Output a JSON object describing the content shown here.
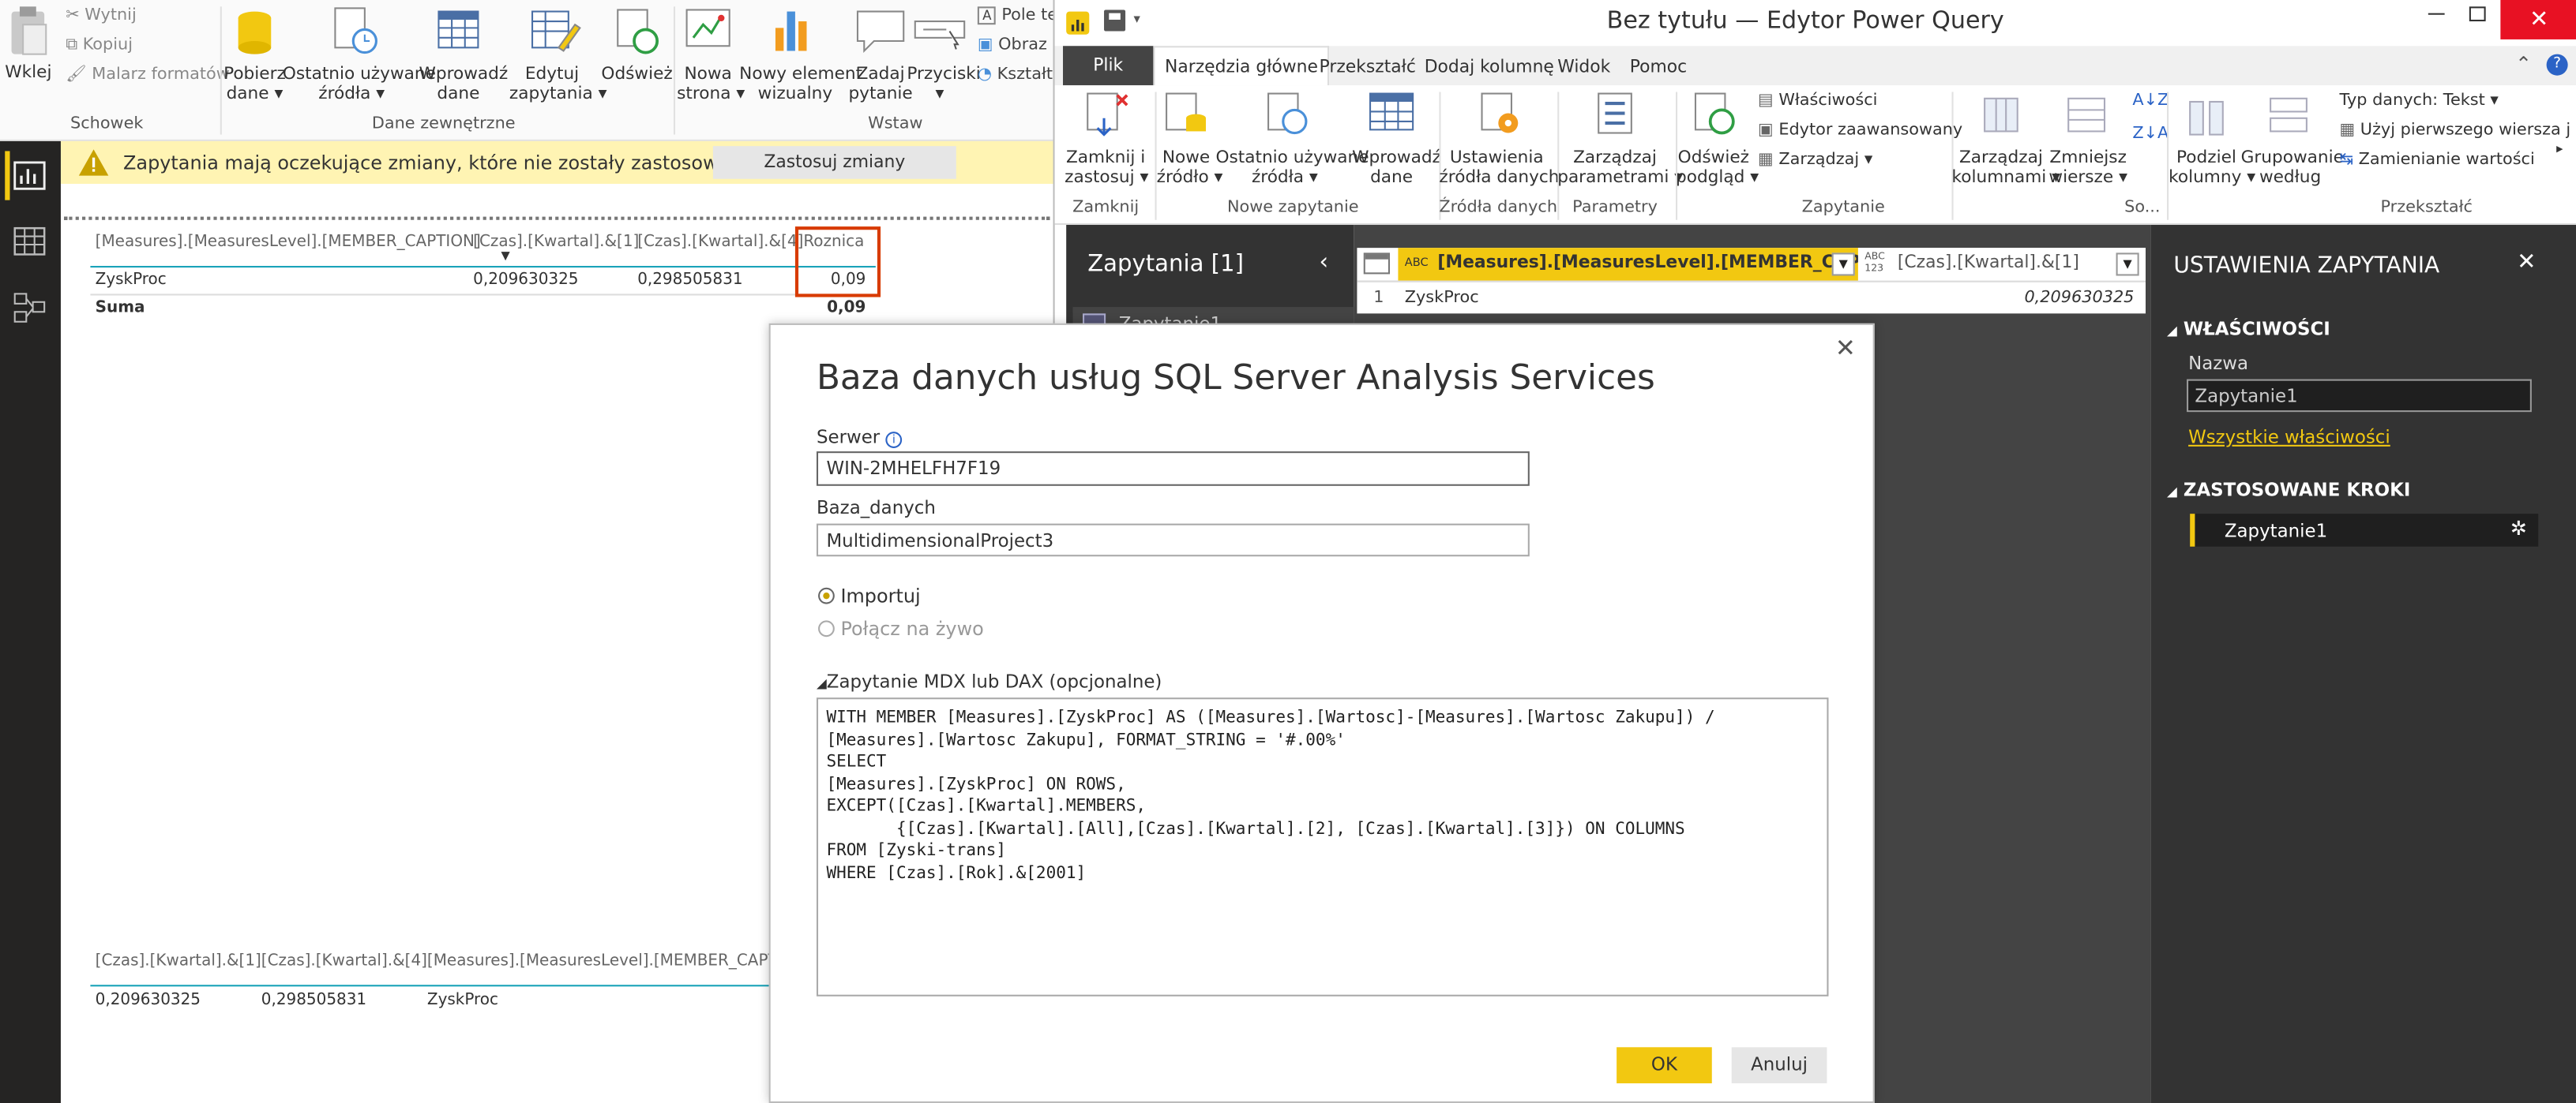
{
  "pbi": {
    "ribbon": {
      "clipboard": {
        "paste": "Wklej",
        "cut": "Wytnij",
        "copy": "Kopiuj",
        "format_painter": "Malarz formatów",
        "group": "Schowek"
      },
      "external": {
        "get_data_1": "Pobierz",
        "get_data_2": "dane",
        "recent_1": "Ostatnio używane",
        "recent_2": "źródła",
        "enter_1": "Wprowadź",
        "enter_2": "dane",
        "edit_1": "Edytuj",
        "edit_2": "zapytania",
        "refresh": "Odśwież",
        "group": "Dane zewnętrzne"
      },
      "insert": {
        "new_page_1": "Nowa",
        "new_page_2": "strona",
        "new_visual_1": "Nowy element",
        "new_visual_2": "wizualny",
        "ask_1": "Zadaj",
        "ask_2": "pytanie",
        "buttons": "Przyciski",
        "textbox": "Pole te",
        "image": "Obraz",
        "shapes": "Kształt",
        "group": "Wstaw"
      }
    },
    "banner": {
      "message": "Zapytania mają oczekujące zmiany, które nie zostały zastosowane.",
      "apply": "Zastosuj zmiany"
    },
    "table1": {
      "headers": [
        "[Measures].[MeasuresLevel].[MEMBER_CAPTION]",
        "[Czas].[Kwartal].&[1]",
        "[Czas].[Kwartal].&[4]",
        "Roznica"
      ],
      "row": [
        "ZyskProc",
        "0,209630325",
        "0,298505831",
        "0,09"
      ],
      "total_label": "Suma",
      "total_value": "0,09"
    },
    "table2": {
      "headers": [
        "[Czas].[Kwartal].&[1]",
        "[Czas].[Kwartal].&[4]",
        "[Measures].[MeasuresLevel].[MEMBER_CAPTIO"
      ],
      "row": [
        "0,209630325",
        "0,298505831",
        "ZyskProc"
      ]
    }
  },
  "pq": {
    "title": "Bez tytułu — Edytor Power Query",
    "tabs": [
      "Plik",
      "Narzędzia główne",
      "Przekształć",
      "Dodaj kolumnę",
      "Widok",
      "Pomoc"
    ],
    "ribbon": {
      "close_1": "Zamknij i",
      "close_2": "zastosuj",
      "g_close": "Zamknij",
      "new_src_1": "Nowe",
      "new_src_2": "źródło",
      "recent_1": "Ostatnio używane",
      "recent_2": "źródła",
      "enter_1": "Wprowadź",
      "enter_2": "dane",
      "g_new": "Nowe zapytanie",
      "ds_1": "Ustawienia",
      "ds_2": "źródła danych",
      "g_ds": "Źródła danych",
      "param_1": "Zarządzaj",
      "param_2": "parametrami",
      "g_param": "Parametry",
      "preview_1": "Odśwież",
      "preview_2": "podgląd",
      "properties": "Właściwości",
      "adv_editor": "Edytor zaawansowany",
      "manage": "Zarządzaj",
      "g_query": "Zapytanie",
      "cols_1": "Zarządzaj",
      "cols_2": "kolumnami",
      "rows_1": "Zmniejsz",
      "rows_2": "wiersze",
      "g_sort": "So...",
      "split_1": "Podziel",
      "split_2": "kolumny",
      "groupby_1": "Grupowanie",
      "groupby_2": "według",
      "dtype": "Typ danych: Tekst",
      "first_row": "Użyj pierwszego wiersza j",
      "replace": "Zamienianie wartości",
      "g_transform": "Przekształć"
    },
    "queries_title": "Zapytania [1]",
    "queries_item": "Zapytanie1",
    "grid": {
      "col1": "[Measures].[MeasuresLevel].[MEMBER_CAPTI...",
      "col1_type": "ABC",
      "col2": "[Czas].[Kwartal].&[1]",
      "col2_type": "ABC 123",
      "row_num": "1",
      "cell1": "ZyskProc",
      "cell2": "0,209630325"
    },
    "settings": {
      "title": "USTAWIENIA ZAPYTANIA",
      "props": "WŁAŚCIWOŚCI",
      "name_label": "Nazwa",
      "name_value": "Zapytanie1",
      "all_props": "Wszystkie właściwości",
      "steps": "ZASTOSOWANE KROKI",
      "step1": "Zapytanie1"
    }
  },
  "dialog": {
    "title": "Baza danych usług SQL Server Analysis Services",
    "server_label": "Serwer",
    "server_value": "WIN-2MHELFH7F19",
    "db_label": "Baza_danych",
    "db_value": "MultidimensionalProject3",
    "import": "Importuj",
    "live": "Połącz na żywo",
    "mdx_label": "Zapytanie MDX lub DAX (opcjonalne)",
    "mdx_lines": [
      "WITH MEMBER [Measures].[ZyskProc] AS ([Measures].[Wartosc]-[Measures].[Wartosc Zakupu]) /",
      "[Measures].[Wartosc Zakupu], FORMAT_STRING = '#.00%'",
      "SELECT",
      "[Measures].[ZyskProc] ON ROWS,",
      "EXCEPT([Czas].[Kwartal].MEMBERS,",
      "       {[Czas].[Kwartal].[All],[Czas].[Kwartal].[2], [Czas].[Kwartal].[3]}) ON COLUMNS",
      "FROM [Zyski-trans]",
      "WHERE [Czas].[Rok].&[2001]"
    ],
    "ok": "OK",
    "cancel": "Anuluj"
  },
  "colors": {
    "accent": "#f2c811",
    "dark_panel": "#1f1f1f",
    "banner": "#fff4b3",
    "highlight": "#d83b01"
  }
}
